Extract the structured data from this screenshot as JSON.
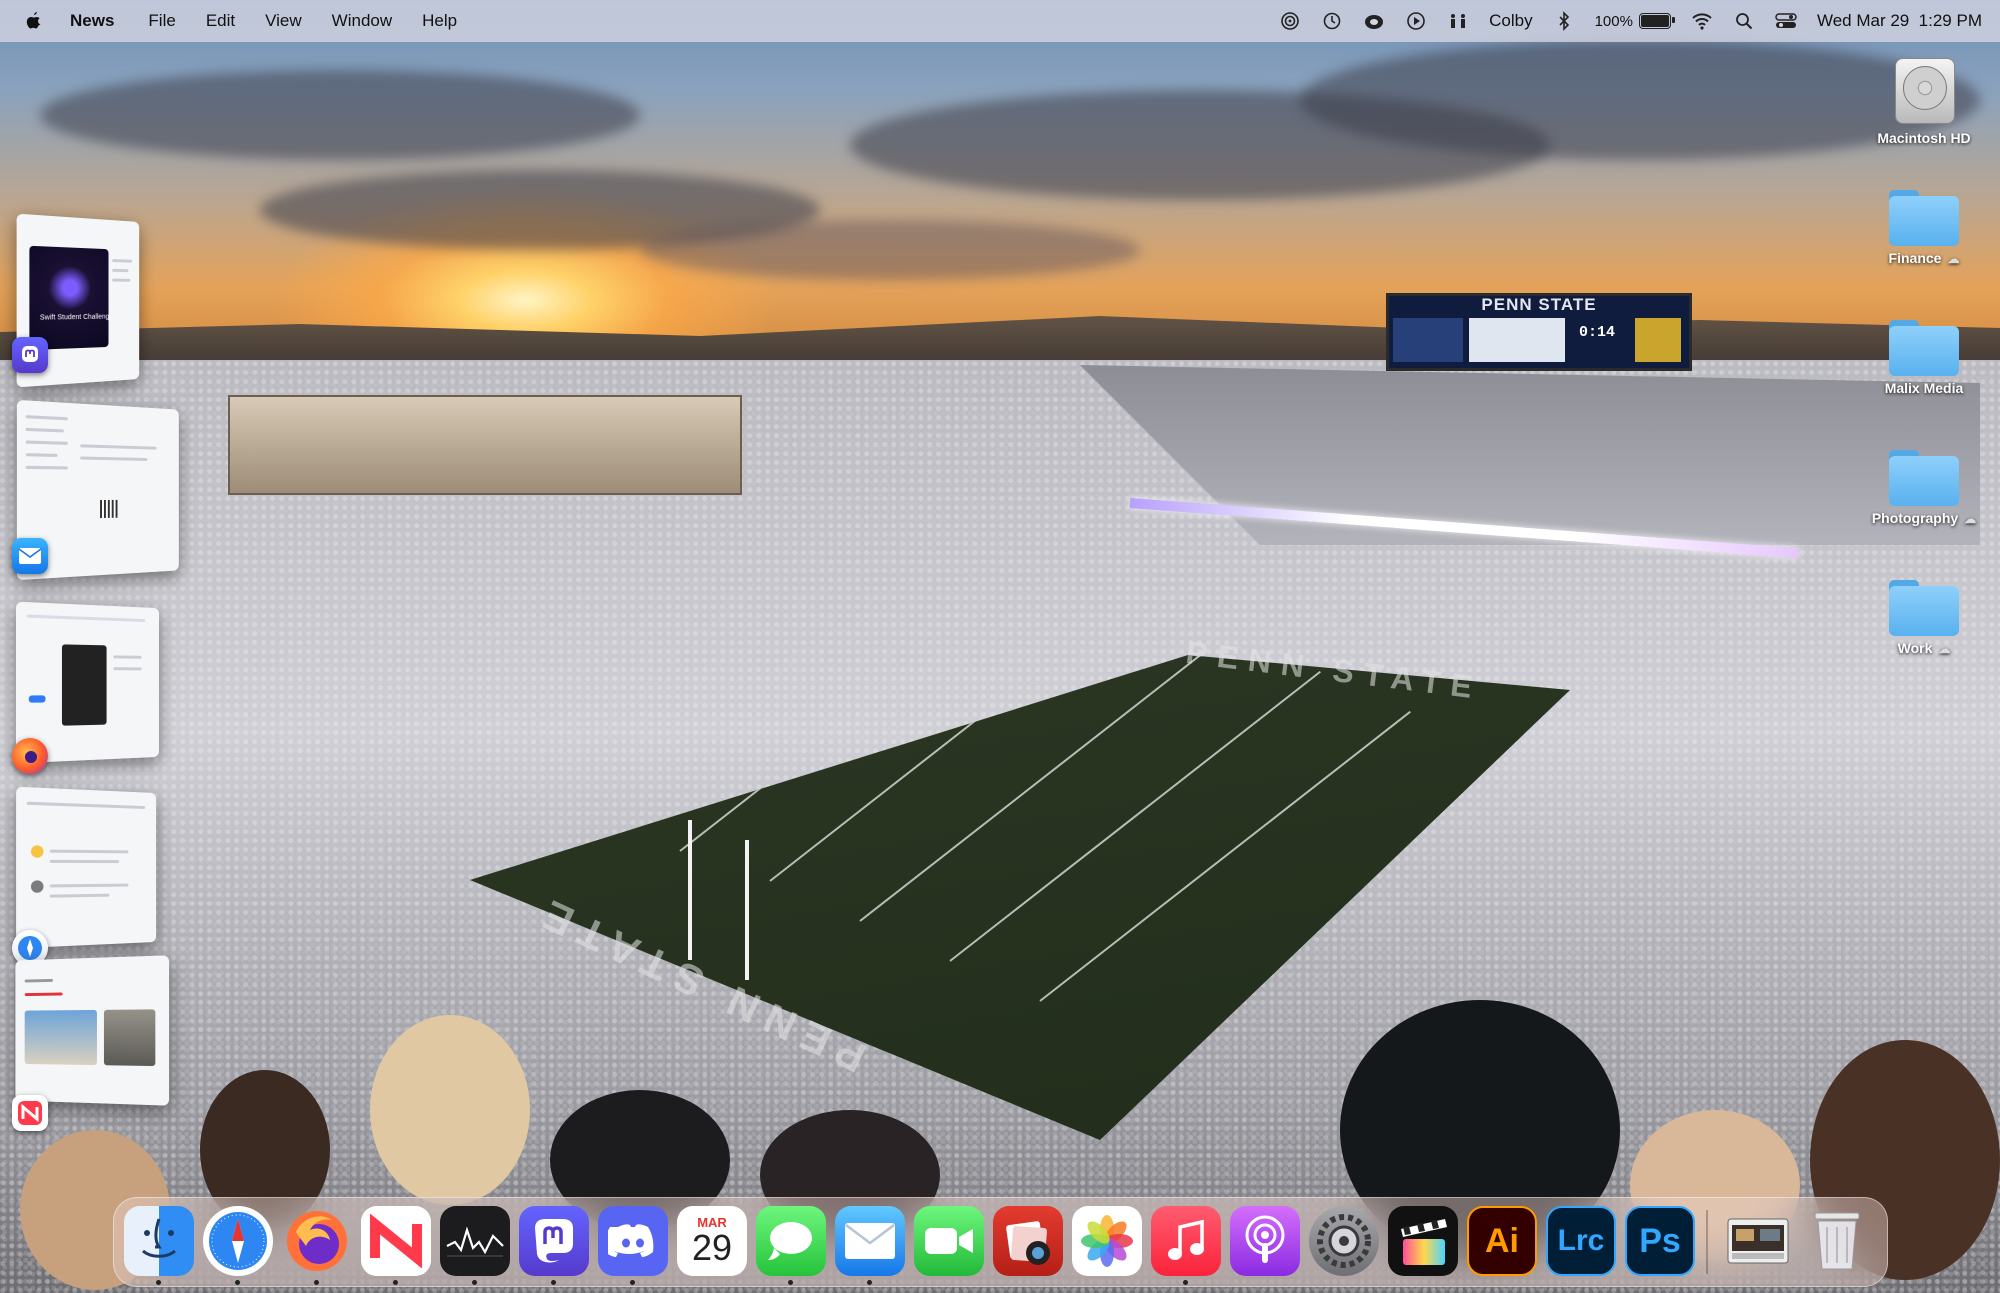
{
  "menubar": {
    "app_name": "News",
    "menus": [
      "File",
      "Edit",
      "View",
      "Window",
      "Help"
    ],
    "user": "Colby",
    "battery_percent": "100%",
    "battery_level": 1.0,
    "clock": "Wed Mar 29  1:29 PM",
    "status_icons": [
      "airdrop-icon",
      "time-machine-icon",
      "creative-cloud-icon",
      "play-icon",
      "accessibility-icon",
      "bluetooth-icon",
      "battery-icon",
      "wifi-icon",
      "spotlight-search-icon",
      "control-center-icon"
    ]
  },
  "desktop": {
    "icons": [
      {
        "label": "Macintosh HD",
        "kind": "hard-drive"
      },
      {
        "label": "Finance",
        "kind": "folder",
        "icloud": true
      },
      {
        "label": "Malix Media",
        "kind": "folder",
        "icloud": false
      },
      {
        "label": "Photography",
        "kind": "folder",
        "icloud": true
      },
      {
        "label": "Work",
        "kind": "folder",
        "icloud": true
      }
    ]
  },
  "wallpaper": {
    "scoreboard_title": "PENN STATE",
    "scoreboard_clock": "0:14",
    "endzone_text": "PENN STATE"
  },
  "stage_manager": {
    "thumb_1_caption": "Swift Student Challenge",
    "apps": [
      "mastodon",
      "mail",
      "firefox",
      "safari",
      "news"
    ]
  },
  "dock": {
    "apps": [
      {
        "name": "Finder",
        "running": true
      },
      {
        "name": "Safari",
        "running": true
      },
      {
        "name": "Firefox",
        "running": true
      },
      {
        "name": "News",
        "running": true
      },
      {
        "name": "Stocks",
        "running": true
      },
      {
        "name": "Mastodon",
        "running": true
      },
      {
        "name": "Discord",
        "running": true
      },
      {
        "name": "Calendar",
        "running": false
      },
      {
        "name": "Messages",
        "running": true
      },
      {
        "name": "Mail",
        "running": true
      },
      {
        "name": "FaceTime",
        "running": false
      },
      {
        "name": "Photo Booth",
        "running": false
      },
      {
        "name": "Photos",
        "running": false
      },
      {
        "name": "Music",
        "running": true
      },
      {
        "name": "Podcasts",
        "running": false
      },
      {
        "name": "System Settings",
        "running": false
      },
      {
        "name": "Final Cut Pro",
        "running": false
      },
      {
        "name": "Illustrator",
        "running": false
      },
      {
        "name": "Lightroom Classic",
        "running": false
      },
      {
        "name": "Photoshop",
        "running": false
      },
      {
        "name": "Downloads",
        "running": false
      },
      {
        "name": "Trash",
        "running": false
      }
    ],
    "calendar_month": "MAR",
    "calendar_day": "29",
    "illustrator_label": "Ai",
    "lightroom_label": "Lrc",
    "photoshop_label": "Ps"
  }
}
